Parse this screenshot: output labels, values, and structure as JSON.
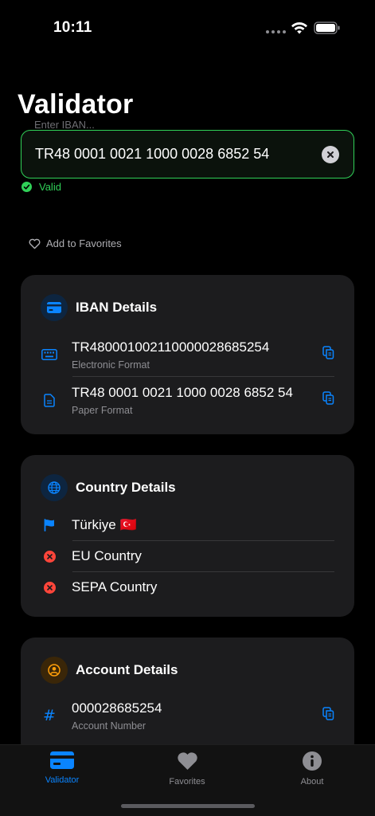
{
  "status_bar": {
    "time": "10:11"
  },
  "page": {
    "title": "Validator"
  },
  "iban_input": {
    "label": "Enter IBAN...",
    "value": "TR48 0001 0021 1000 0028 6852 54"
  },
  "validation": {
    "status_text": "Valid",
    "color": "#30d158"
  },
  "favorites_action": {
    "label": "Add to Favorites"
  },
  "iban_details": {
    "title": "IBAN Details",
    "rows": [
      {
        "value": "TR480001002110000028685254",
        "label": "Electronic Format",
        "icon": "keyboard-icon"
      },
      {
        "value": "TR48 0001 0021 1000 0028 6852 54",
        "label": "Paper Format",
        "icon": "document-icon"
      }
    ]
  },
  "country_details": {
    "title": "Country Details",
    "rows": [
      {
        "value": "Türkiye 🇹🇷",
        "icon": "flag-icon"
      },
      {
        "value": "EU Country",
        "icon": "x-circle-icon"
      },
      {
        "value": "SEPA Country",
        "icon": "x-circle-icon"
      }
    ]
  },
  "account_details": {
    "title": "Account Details",
    "rows": [
      {
        "value": "000028685254",
        "label": "Account Number",
        "icon": "hash-icon"
      }
    ]
  },
  "tab_bar": {
    "tabs": [
      {
        "label": "Validator",
        "icon": "card-icon",
        "active": true
      },
      {
        "label": "Favorites",
        "icon": "heart-icon",
        "active": false
      },
      {
        "label": "About",
        "icon": "info-icon",
        "active": false
      }
    ]
  },
  "colors": {
    "accent": "#0a84ff",
    "valid": "#30d158",
    "invalid": "#ff453a",
    "account_accent": "#ff9f0a"
  }
}
